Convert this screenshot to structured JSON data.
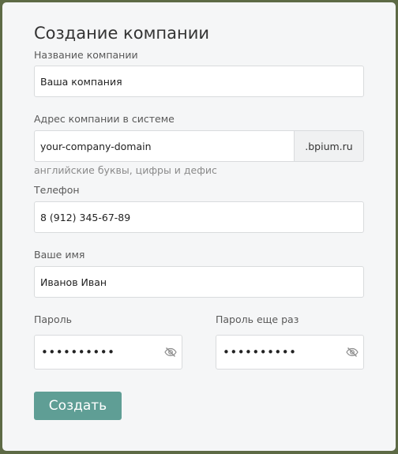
{
  "form": {
    "title": "Создание компании",
    "company_name": {
      "label": "Название компании",
      "value": "Ваша компания"
    },
    "domain": {
      "label": "Адрес компании в системе",
      "value": "your-company-domain",
      "suffix": ".bpium.ru",
      "hint": "английские буквы, цифры и дефис"
    },
    "phone": {
      "label": "Телефон",
      "value": "8 (912) 345-67-89"
    },
    "name": {
      "label": "Ваше имя",
      "value": "Иванов Иван"
    },
    "password": {
      "label": "Пароль",
      "masked": "••••••••••",
      "icon": "eye-slash-icon"
    },
    "password_repeat": {
      "label": "Пароль еще раз",
      "masked": "••••••••••",
      "icon": "eye-slash-icon"
    },
    "submit_label": "Создать"
  },
  "colors": {
    "background": "#5d6a45",
    "card": "#f5f6f7",
    "button": "#5f9e95"
  }
}
